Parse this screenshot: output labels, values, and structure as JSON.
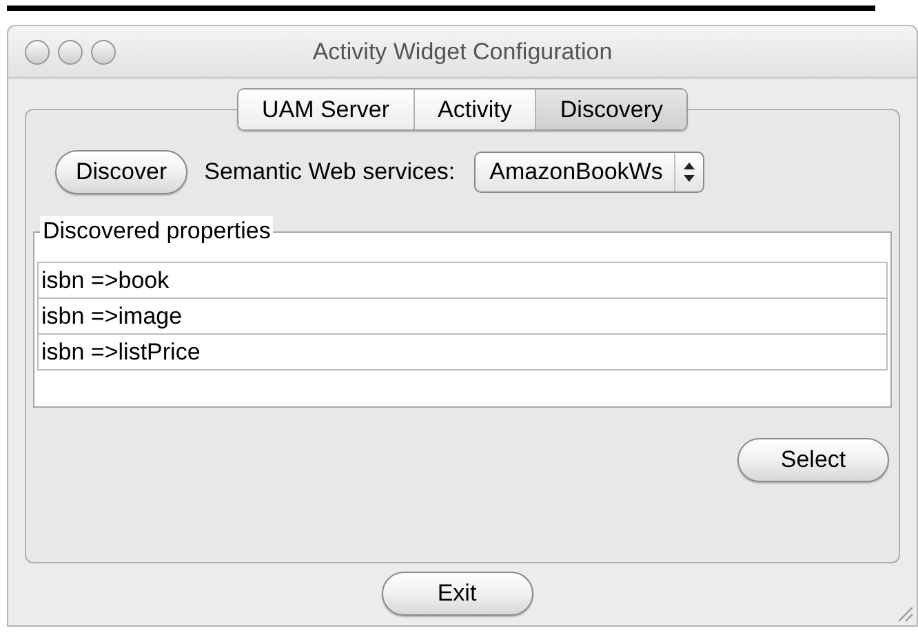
{
  "window": {
    "title": "Activity Widget Configuration"
  },
  "tabs": [
    {
      "label": "UAM Server",
      "selected": false
    },
    {
      "label": "Activity",
      "selected": false
    },
    {
      "label": "Discovery",
      "selected": true
    }
  ],
  "discover_button": "Discover",
  "services": {
    "label": "Semantic Web services:",
    "value": "AmazonBookWs"
  },
  "properties": {
    "title": "Discovered properties",
    "items": [
      "isbn =>book",
      "isbn =>image",
      "isbn =>listPrice"
    ]
  },
  "select_button": "Select",
  "exit_button": "Exit"
}
